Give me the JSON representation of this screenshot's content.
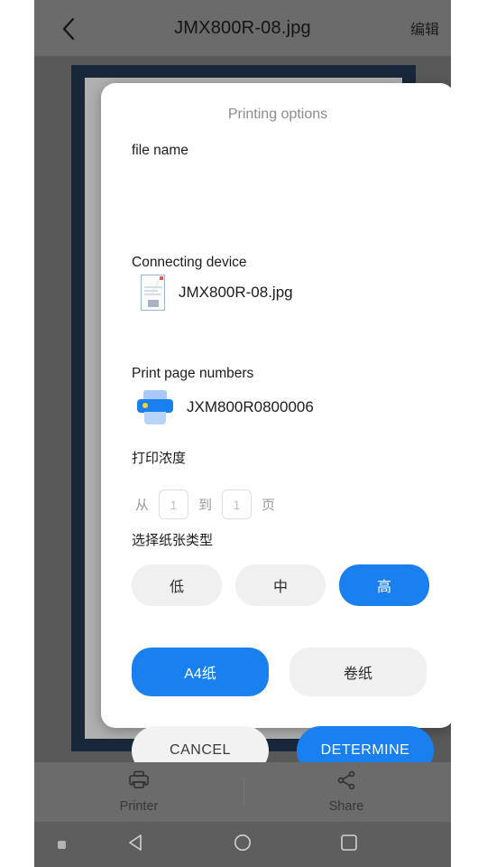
{
  "appbar": {
    "back_icon": "chevron-left-icon",
    "title": "JMX800R-08.jpg",
    "edit_label": "编辑"
  },
  "dialog": {
    "title": "Printing options",
    "file_section": {
      "label": "file name",
      "thumb_icon": "image-file-thumbnail",
      "file_name": "JMX800R-08.jpg"
    },
    "device_section": {
      "label": "Connecting device",
      "printer_icon": "printer-icon",
      "device_name": "JXM800R0800006"
    },
    "page_section": {
      "label": "Print page numbers",
      "from_word": "从",
      "from_value": "1",
      "to_word": "到",
      "to_value": "1",
      "unit_word": "页"
    },
    "density_section": {
      "label": "打印浓度",
      "options": [
        {
          "label": "低",
          "selected": false
        },
        {
          "label": "中",
          "selected": false
        },
        {
          "label": "高",
          "selected": true
        }
      ]
    },
    "paper_section": {
      "label": "选择纸张类型",
      "options": [
        {
          "label": "A4纸",
          "selected": true
        },
        {
          "label": "卷纸",
          "selected": false
        }
      ]
    },
    "actions": {
      "cancel_label": "CANCEL",
      "determine_label": "DETERMINE"
    }
  },
  "bottombar": {
    "printer": {
      "icon": "printer-outline-icon",
      "label": "Printer"
    },
    "share": {
      "icon": "share-nodes-icon",
      "label": "Share"
    }
  },
  "navbar": {
    "dot_icon": "square-dot-icon",
    "back_icon": "triangle-back-icon",
    "home_icon": "circle-home-icon",
    "recent_icon": "square-recents-icon"
  },
  "colors": {
    "accent_blue": "#1a80ef",
    "chip_off": "#f0f0f0",
    "screen_gray": "#666666",
    "preview_navy": "#1d2d44"
  }
}
